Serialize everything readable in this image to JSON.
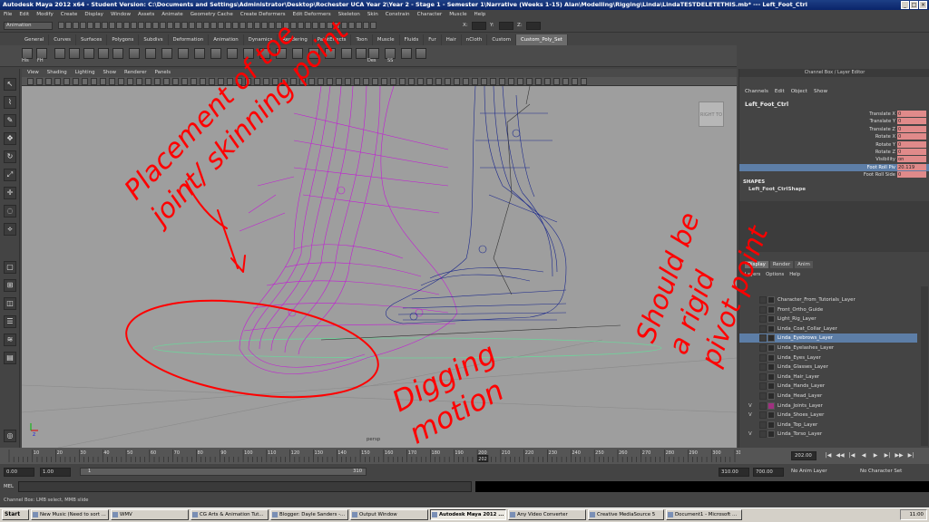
{
  "window": {
    "title": "Autodesk Maya 2012 x64 - Student Version: C:\\Documents and Settings\\Administrator\\Desktop\\Rochester UCA Year 2\\Year 2 - Stage 1 - Semester 1\\Narrative (Weeks 1-15) Alan\\Modelling\\Rigging\\Linda\\LindaTESTDELETETHIS.mb*  ---  Left_Foot_Ctrl"
  },
  "menubar": [
    "File",
    "Edit",
    "Modify",
    "Create",
    "Display",
    "Window",
    "Assets",
    "Animate",
    "Geometry Cache",
    "Create Deformers",
    "Edit Deformers",
    "Skeleton",
    "Skin",
    "Constrain",
    "Character",
    "Muscle",
    "Help"
  ],
  "statusline": {
    "mode": "Animation",
    "x_label": "X:",
    "y_label": "Y:",
    "z_label": "Z:"
  },
  "shelf": {
    "tabs": [
      "General",
      "Curves",
      "Surfaces",
      "Polygons",
      "Subdivs",
      "Deformation",
      "Animation",
      "Dynamics",
      "Rendering",
      "PaintEffects",
      "Toon",
      "Muscle",
      "Fluids",
      "Fur",
      "Hair",
      "nCloth",
      "Custom",
      "Custom_Poly_Set"
    ],
    "active_tab": "Custom_Poly_Set",
    "icon_labels": [
      "His",
      "FH",
      "Des",
      "SS"
    ]
  },
  "viewport": {
    "panel_menu": [
      "View",
      "Shading",
      "Lighting",
      "Show",
      "Renderer",
      "Panels"
    ],
    "viewcube_label": "RIGHT",
    "viewcube_side": "TO",
    "camera_label": "persp",
    "axis_label": "z"
  },
  "annotations": {
    "note1": "Placement of toe joint/ skinning point",
    "note2": "Digging motion",
    "note3": "Should be a rigid pivot point",
    "ink_color": "#ff0000"
  },
  "channel_box": {
    "title": "Channel Box / Layer Editor",
    "menu": [
      "Channels",
      "Edit",
      "Object",
      "Show"
    ],
    "object": "Left_Foot_Ctrl",
    "attributes": [
      {
        "name": "Translate X",
        "value": "0"
      },
      {
        "name": "Translate Y",
        "value": "0"
      },
      {
        "name": "Translate Z",
        "value": "0"
      },
      {
        "name": "Rotate X",
        "value": "0"
      },
      {
        "name": "Rotate Y",
        "value": "0"
      },
      {
        "name": "Rotate Z",
        "value": "0"
      },
      {
        "name": "Visibility",
        "value": "on"
      },
      {
        "name": "Foot Roll Piv",
        "value": "20.119"
      },
      {
        "name": "Foot Roll Side",
        "value": "0"
      }
    ],
    "selected_attribute": "Foot Roll Piv",
    "shapes_heading": "SHAPES",
    "shape_name": "Left_Foot_CtrlShape"
  },
  "layer_editor": {
    "tabs": [
      "Display",
      "Render",
      "Anim"
    ],
    "active_tab": "Display",
    "menu": [
      "Layers",
      "Options",
      "Help"
    ],
    "layers": [
      {
        "name": "Character_From_Tutorials_Layer",
        "vis": "",
        "color": ""
      },
      {
        "name": "Front_Ortho_Guide",
        "vis": "",
        "color": ""
      },
      {
        "name": "Light_Rig_Layer",
        "vis": "",
        "color": ""
      },
      {
        "name": "Linda_Coat_Collar_Layer",
        "vis": "",
        "color": ""
      },
      {
        "name": "Linda_Eyebrows_Layer",
        "vis": "",
        "color": ""
      },
      {
        "name": "Linda_Eyelashes_Layer",
        "vis": "",
        "color": ""
      },
      {
        "name": "Linda_Eyes_Layer",
        "vis": "",
        "color": ""
      },
      {
        "name": "Linda_Glasses_Layer",
        "vis": "",
        "color": ""
      },
      {
        "name": "Linda_Hair_Layer",
        "vis": "",
        "color": ""
      },
      {
        "name": "Linda_Hands_Layer",
        "vis": "",
        "color": ""
      },
      {
        "name": "Linda_Head_Layer",
        "vis": "",
        "color": ""
      },
      {
        "name": "Linda_Joints_Layer",
        "vis": "V",
        "color": "#a03080"
      },
      {
        "name": "Linda_Shoes_Layer",
        "vis": "V",
        "color": ""
      },
      {
        "name": "Linda_Top_Layer",
        "vis": "",
        "color": ""
      },
      {
        "name": "Linda_Torso_Layer",
        "vis": "V",
        "color": ""
      }
    ],
    "selected_layer": "Linda_Eyebrows_Layer"
  },
  "timeline": {
    "ticks": [
      "10",
      "20",
      "30",
      "40",
      "50",
      "60",
      "70",
      "80",
      "90",
      "100",
      "110",
      "120",
      "130",
      "140",
      "150",
      "160",
      "170",
      "180",
      "190",
      "200",
      "210",
      "220",
      "230",
      "240",
      "250",
      "260",
      "270",
      "280",
      "290",
      "300",
      "310"
    ],
    "marker": "202",
    "current_frame": "202.00",
    "playback_buttons": [
      "|◀",
      "◀◀",
      "|◀",
      "◀",
      "▶",
      "▶|",
      "▶▶",
      "▶|"
    ]
  },
  "range": {
    "start": "0.00",
    "inner_start": "1.00",
    "slider_start": "1",
    "slider_end": "310",
    "inner_end": "310.00",
    "end": "700.00",
    "anim_layer": "No Anim Layer",
    "character_set": "No Character Set"
  },
  "mel": {
    "label": "MEL"
  },
  "help_line": "Channel Box: LMB select, MMB slide",
  "taskbar": {
    "start": "Start",
    "tasks": [
      {
        "label": "New Music (Need to sort ..."
      },
      {
        "label": "WMV"
      },
      {
        "label": "CG Arts & Animation Tut..."
      },
      {
        "label": "Blogger: Dayle Sanders -..."
      },
      {
        "label": "Output Window"
      },
      {
        "label": "Autodesk Maya 2012 ..."
      },
      {
        "label": "Any Video Converter"
      },
      {
        "label": "Creative MediaSource 5"
      },
      {
        "label": "Document1 - Microsoft ..."
      }
    ],
    "active_task": "Autodesk Maya 2012 ...",
    "clock": "11:00"
  }
}
